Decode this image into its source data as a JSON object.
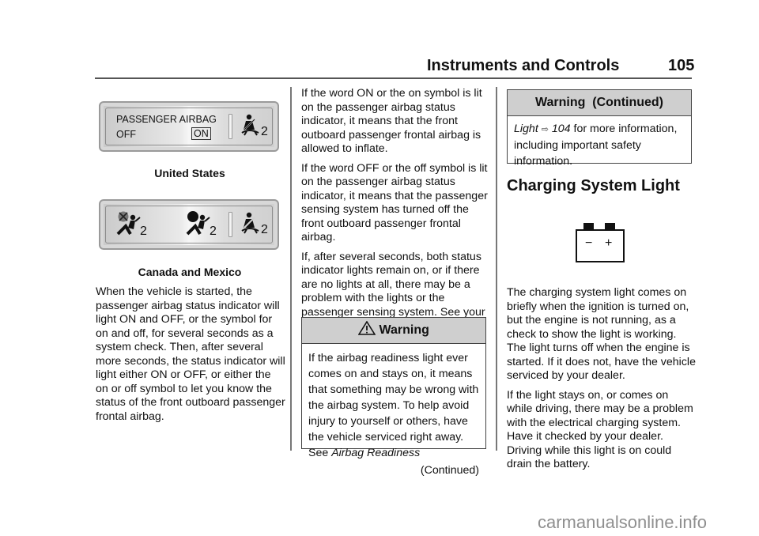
{
  "header": {
    "section_title": "Instruments and Controls",
    "page_number": "105"
  },
  "left_column": {
    "figure_us": {
      "panel_line1": "PASSENGER AIRBAG",
      "off_label": "OFF",
      "on_label": "ON",
      "seatbelt_sub": "2",
      "caption": "United States"
    },
    "figure_canada": {
      "airbag_off_sub": "2",
      "airbag_on_sub": "2",
      "seatbelt_sub": "2",
      "caption": "Canada and Mexico"
    },
    "paragraph": "When the vehicle is started, the passenger airbag status indicator will light ON and OFF, or the symbol for on and off, for several seconds as a system check. Then, after several more seconds, the status indicator will light either ON or OFF, or either the on or off symbol to let you know the status of the front outboard passenger frontal airbag."
  },
  "middle_column": {
    "paragraphs": [
      "If the word ON or the on symbol is lit on the passenger airbag status indicator, it means that the front outboard passenger frontal airbag is allowed to inflate.",
      "If the word OFF or the off symbol is lit on the passenger airbag status indicator, it means that the passenger sensing system has turned off the front outboard passenger frontal airbag.",
      "If, after several seconds, both status indicator lights remain on, or if there are no lights at all, there may be a problem with the lights or the passenger sensing system. See your dealer for service."
    ],
    "warning": {
      "icon": "warning-triangle-icon",
      "title": "Warning",
      "body": "If the airbag readiness light ever comes on and stays on, it means that something may be wrong with the airbag system. To help avoid injury to yourself or others, have the vehicle serviced right away. See ",
      "link_text": "Airbag Readiness",
      "continued": "(Continued)"
    }
  },
  "right_column": {
    "warning_continued": {
      "title": "Warning  (Continued)",
      "link_text": "Light",
      "ref_icon": "page-reference-arrow-icon",
      "ref_page": "104",
      "body_rest": " for more information, including important safety information."
    },
    "section_title": "Charging System Light",
    "battery_icon": {
      "minus": "−",
      "plus": "+"
    },
    "paragraphs": [
      "The charging system light comes on briefly when the ignition is turned on, but the engine is not running, as a check to show the light is working. The light turns off when the engine is started. If it does not, have the vehicle serviced by your dealer.",
      "If the light stays on, or comes on while driving, there may be a problem with the electrical charging system. Have it checked by your dealer. Driving while this light is on could drain the battery."
    ]
  },
  "watermark": "carmanualsonline.info"
}
